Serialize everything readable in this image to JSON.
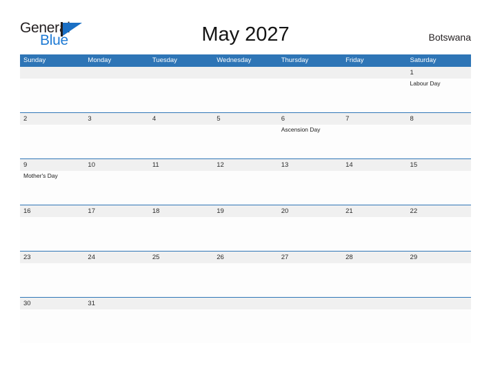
{
  "brand": {
    "name_part1": "General",
    "name_part2": "Blue",
    "flag_icon": "flag-triangle-icon",
    "color_dark": "#231f20",
    "color_blue": "#1e7ad4"
  },
  "header": {
    "title": "May 2027",
    "country": "Botswana"
  },
  "theme": {
    "header_blue": "#2e75b6",
    "band_gray": "#f0f0f0",
    "page_background": "#ffffff",
    "text_dark": "#2a2a2a"
  },
  "calendar": {
    "month": "May",
    "year": "2027",
    "weekday_headers": [
      "Sunday",
      "Monday",
      "Tuesday",
      "Wednesday",
      "Thursday",
      "Friday",
      "Saturday"
    ],
    "weeks": [
      {
        "days": [
          {
            "date": "",
            "event": ""
          },
          {
            "date": "",
            "event": ""
          },
          {
            "date": "",
            "event": ""
          },
          {
            "date": "",
            "event": ""
          },
          {
            "date": "",
            "event": ""
          },
          {
            "date": "",
            "event": ""
          },
          {
            "date": "1",
            "event": "Labour Day"
          }
        ]
      },
      {
        "days": [
          {
            "date": "2",
            "event": ""
          },
          {
            "date": "3",
            "event": ""
          },
          {
            "date": "4",
            "event": ""
          },
          {
            "date": "5",
            "event": ""
          },
          {
            "date": "6",
            "event": "Ascension Day"
          },
          {
            "date": "7",
            "event": ""
          },
          {
            "date": "8",
            "event": ""
          }
        ]
      },
      {
        "days": [
          {
            "date": "9",
            "event": "Mother's Day"
          },
          {
            "date": "10",
            "event": ""
          },
          {
            "date": "11",
            "event": ""
          },
          {
            "date": "12",
            "event": ""
          },
          {
            "date": "13",
            "event": ""
          },
          {
            "date": "14",
            "event": ""
          },
          {
            "date": "15",
            "event": ""
          }
        ]
      },
      {
        "days": [
          {
            "date": "16",
            "event": ""
          },
          {
            "date": "17",
            "event": ""
          },
          {
            "date": "18",
            "event": ""
          },
          {
            "date": "19",
            "event": ""
          },
          {
            "date": "20",
            "event": ""
          },
          {
            "date": "21",
            "event": ""
          },
          {
            "date": "22",
            "event": ""
          }
        ]
      },
      {
        "days": [
          {
            "date": "23",
            "event": ""
          },
          {
            "date": "24",
            "event": ""
          },
          {
            "date": "25",
            "event": ""
          },
          {
            "date": "26",
            "event": ""
          },
          {
            "date": "27",
            "event": ""
          },
          {
            "date": "28",
            "event": ""
          },
          {
            "date": "29",
            "event": ""
          }
        ]
      },
      {
        "days": [
          {
            "date": "30",
            "event": ""
          },
          {
            "date": "31",
            "event": ""
          },
          {
            "date": "",
            "event": ""
          },
          {
            "date": "",
            "event": ""
          },
          {
            "date": "",
            "event": ""
          },
          {
            "date": "",
            "event": ""
          },
          {
            "date": "",
            "event": ""
          }
        ]
      }
    ]
  }
}
